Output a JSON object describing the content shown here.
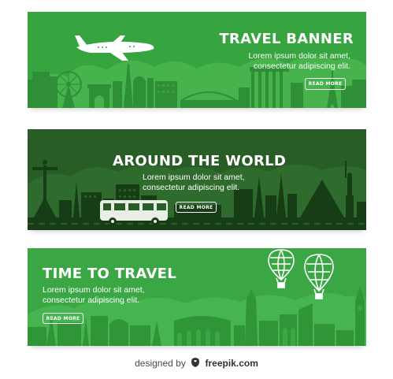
{
  "colors": {
    "banner1_bg": "#37a53f",
    "banner2_bg": "#285d26",
    "banner3_bg": "#3aa744",
    "text": "#ffffff"
  },
  "banners": [
    {
      "title": "TRAVEL BANNER",
      "body_line1": "Lorem ipsum dolor sit amet,",
      "body_line2": "consectetur adipiscing elit.",
      "button": "READ MORE",
      "icons": [
        "airplane-icon",
        "ferris-wheel-icon",
        "arc-de-triomphe-icon",
        "bridge-icon",
        "colosseum-icon",
        "eiffel-tower-icon"
      ]
    },
    {
      "title": "AROUND THE WORLD",
      "body_line1": "Lorem ipsum dolor sit amet,",
      "body_line2": "consectetur adipiscing elit.",
      "button": "READ MORE",
      "icons": [
        "christ-redeemer-icon",
        "bus-icon",
        "pyramid-icon",
        "statue-of-liberty-icon"
      ]
    },
    {
      "title": "TIME TO TRAVEL",
      "body_line1": "Lorem ipsum dolor sit amet,",
      "body_line2": "consectetur adipiscing elit.",
      "button": "READ MORE",
      "icons": [
        "hot-air-balloon-icon",
        "colosseum-icon",
        "big-ben-icon"
      ]
    }
  ],
  "credit": {
    "prefix": "designed by",
    "brand": "freepik.com",
    "icon": "freepik-logo-icon"
  }
}
